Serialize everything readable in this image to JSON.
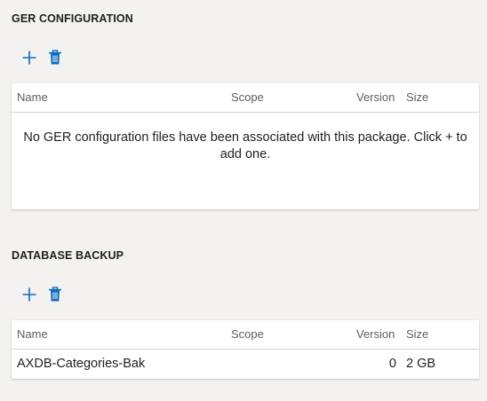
{
  "colors": {
    "accent": "#0f6cbd",
    "background": "#f3f2f1",
    "card": "#ffffff"
  },
  "ger": {
    "title": "GER CONFIGURATION",
    "toolbar": {
      "add_icon": "plus-icon",
      "delete_icon": "trash-icon"
    },
    "columns": {
      "name": "Name",
      "scope": "Scope",
      "version": "Version",
      "size": "Size"
    },
    "empty_message": "No GER configuration files have been associated with this package. Click + to add one."
  },
  "backup": {
    "title": "DATABASE BACKUP",
    "toolbar": {
      "add_icon": "plus-icon",
      "delete_icon": "trash-icon"
    },
    "columns": {
      "name": "Name",
      "scope": "Scope",
      "version": "Version",
      "size": "Size"
    },
    "rows": [
      {
        "name": "AXDB-Categories-Bak",
        "scope": "",
        "version": "0",
        "size": "2 GB"
      }
    ]
  }
}
